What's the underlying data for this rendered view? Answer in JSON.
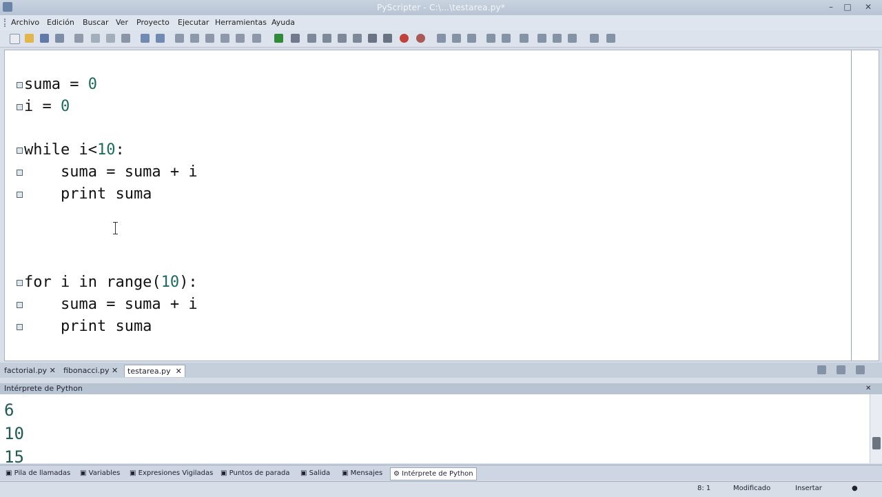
{
  "window": {
    "title": "PyScripter - C:\\...\\testarea.py*",
    "controls": [
      "–",
      "□",
      "✕"
    ]
  },
  "menu": [
    "Archivo",
    "Edición",
    "Buscar",
    "Ver",
    "Proyecto",
    "Ejecutar",
    "Herramientas",
    "Ayuda"
  ],
  "editor": {
    "lines": [
      {
        "pre": "suma = ",
        "num": "0",
        "post": ""
      },
      {
        "pre": "i = ",
        "num": "0",
        "post": ""
      },
      {
        "pre": "while i<",
        "num": "10",
        "post": ":"
      },
      {
        "pre": "    suma = suma + i",
        "num": "",
        "post": ""
      },
      {
        "pre": "    print suma",
        "num": "",
        "post": ""
      },
      {
        "pre": "for i in range(",
        "num": "10",
        "post": "):"
      },
      {
        "pre": "    suma = suma + i",
        "num": "",
        "post": ""
      },
      {
        "pre": "    print suma",
        "num": "",
        "post": ""
      }
    ]
  },
  "file_tabs": [
    {
      "label": "factorial.py",
      "close": "✕"
    },
    {
      "label": "fibonacci.py",
      "close": "✕"
    },
    {
      "label": "testarea.py",
      "close": "✕"
    }
  ],
  "panel": {
    "title": "Intérprete de Python"
  },
  "console": {
    "lines": [
      "6",
      "10",
      "15"
    ]
  },
  "bottom_tabs": [
    "Pila de llamadas",
    "Variables",
    "Expresiones Vigiladas",
    "Puntos de parada",
    "Salida",
    "Mensajes",
    "Intérprete de Python"
  ],
  "status": {
    "position": "8: 1",
    "modified": "Modificado",
    "mode": "Insertar"
  }
}
